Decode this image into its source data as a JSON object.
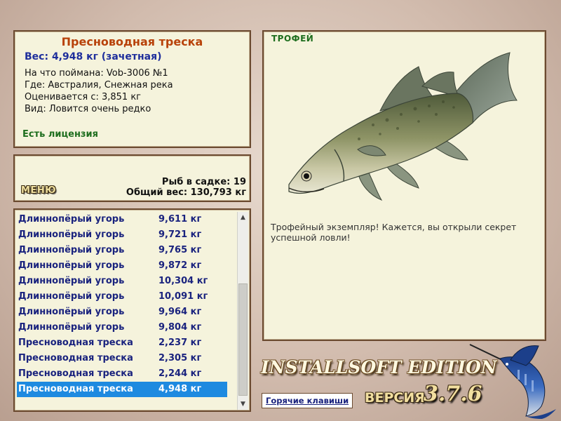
{
  "fish_info": {
    "name": "Пресноводная треска",
    "weight": "Вес: 4,948 кг (зачетная)",
    "caught_on": "На что поймана: Vob-3006 №1",
    "location": "Где: Австралия, Снежная река",
    "valued_from": "Оценивается с: 3,851 кг",
    "rarity": "Вид: Ловится очень редко",
    "license": "Есть лицензия"
  },
  "menu": {
    "button_label": "МЕНЮ",
    "fish_in_keepnet": "Рыб в садке: 19",
    "total_weight": "Общий вес: 130,793 кг"
  },
  "catch_list": [
    {
      "name": "Длиннопёрый угорь",
      "weight": "9,611 кг"
    },
    {
      "name": "Длиннопёрый угорь",
      "weight": "9,721 кг"
    },
    {
      "name": "Длиннопёрый угорь",
      "weight": "9,765 кг"
    },
    {
      "name": "Длиннопёрый угорь",
      "weight": "9,872 кг"
    },
    {
      "name": "Длиннопёрый угорь",
      "weight": "10,304 кг"
    },
    {
      "name": "Длиннопёрый угорь",
      "weight": "10,091 кг"
    },
    {
      "name": "Длиннопёрый угорь",
      "weight": "9,964 кг"
    },
    {
      "name": "Длиннопёрый угорь",
      "weight": "9,804 кг"
    },
    {
      "name": "Пресноводная треска",
      "weight": "2,237 кг"
    },
    {
      "name": "Пресноводная треска",
      "weight": "2,305 кг"
    },
    {
      "name": "Пресноводная треска",
      "weight": "2,244 кг"
    },
    {
      "name": "Пресноводная треска",
      "weight": "4,948 кг",
      "selected": true
    }
  ],
  "trophy": {
    "label": "ТРОФЕЙ",
    "description": "Трофейный экземпляр! Кажется, вы открыли секрет успешной ловли!"
  },
  "brand": {
    "edition": "INSTALLSOFT EDITION",
    "version_label": "ВЕРСИЯ",
    "version_number": "3.7.6"
  },
  "hotkeys_label": "Горячие клавиши",
  "colors": {
    "title": "#b8420a",
    "weight": "#1f2f9c",
    "license": "#1e6e1e",
    "list_text": "#1a237e",
    "selection": "#1e8ae0",
    "panel_bg": "#f5f3dc",
    "panel_border": "#6b4a30"
  }
}
